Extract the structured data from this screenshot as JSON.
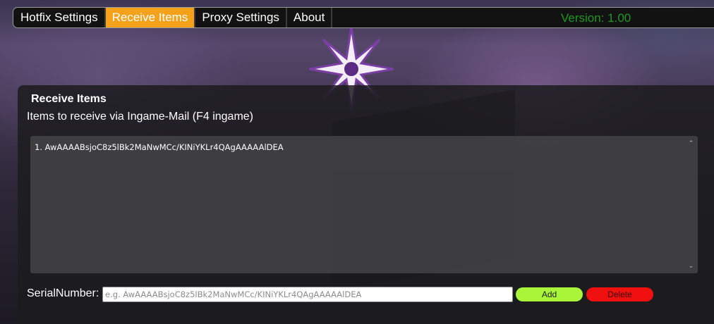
{
  "tabs": [
    {
      "label": "Hotfix Settings",
      "active": false
    },
    {
      "label": "Receive Items",
      "active": true
    },
    {
      "label": "Proxy Settings",
      "active": false
    },
    {
      "label": "About",
      "active": false
    }
  ],
  "version": "Version: 1.00",
  "panel": {
    "title": "Receive Items",
    "subtitle": "Items to receive via Ingame-Mail (F4 ingame)",
    "items": [
      "AwAAAABsjoC8z5lBk2MaNwMCc/KINiYKLr4QAgAAAAAlDEA"
    ],
    "serial": {
      "label": "SerialNumber:",
      "value": "",
      "placeholder": "e.g. AwAAAABsjoC8z5lBk2MaNwMCc/KINiYKLr4QAgAAAAAlDEA"
    },
    "add_label": "Add",
    "delete_label": "Delete"
  },
  "colors": {
    "active_tab": "#f5a11a",
    "version_text": "#1f9a1f",
    "add_button": "#a8f53a",
    "delete_button": "#f01010"
  },
  "icons": {
    "scroll_up": "chevron-up-icon",
    "scroll_down": "chevron-down-icon"
  }
}
